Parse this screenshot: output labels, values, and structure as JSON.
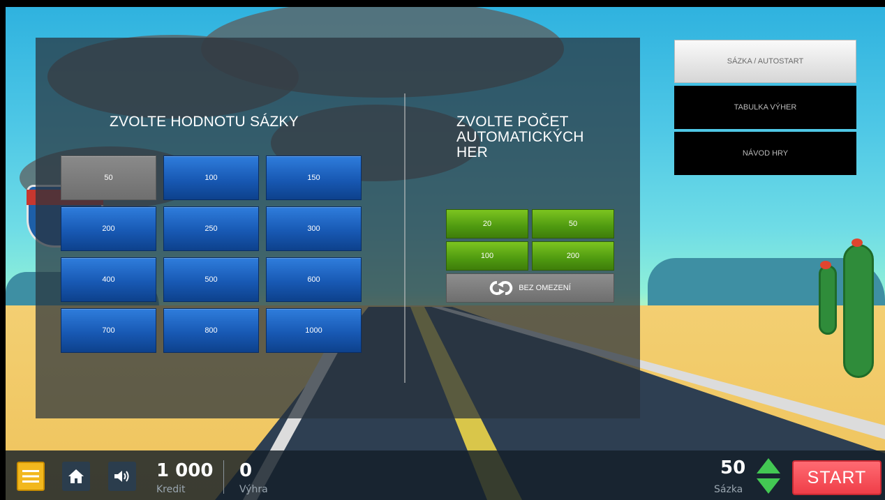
{
  "bet_panel": {
    "heading": "ZVOLTE HODNOTU SÁZKY",
    "options": [
      "50",
      "100",
      "150",
      "200",
      "250",
      "300",
      "400",
      "500",
      "600",
      "700",
      "800",
      "1000"
    ],
    "selected": "50"
  },
  "auto_panel": {
    "heading": "ZVOLTE POČET AUTOMATICKÝCH HER",
    "options": [
      "20",
      "50",
      "100",
      "200"
    ],
    "unlimited_label": "BEZ OMEZENÍ",
    "unlimited_icon": "repeat-icon"
  },
  "menu": {
    "items": [
      "SÁZKA / AUTOSTART",
      "TABULKA VÝHER",
      "NÁVOD HRY"
    ],
    "active": "SÁZKA / AUTOSTART"
  },
  "bottom_bar": {
    "credit_value": "1 000",
    "credit_label": "Kredit",
    "win_value": "0",
    "win_label": "Výhra",
    "bet_value": "50",
    "bet_label": "Sázka",
    "start_label": "START",
    "icons": [
      "menu-icon",
      "home-icon",
      "speaker-icon",
      "arrow-up-icon",
      "arrow-down-icon"
    ]
  },
  "colors": {
    "bet_button": "#1859b4",
    "auto_button": "#4f9a10",
    "selected_button": "#7a7a7a",
    "start_button": "#ef3e48",
    "menu_button": "#f2b81e",
    "arrow_green": "#43c853"
  }
}
